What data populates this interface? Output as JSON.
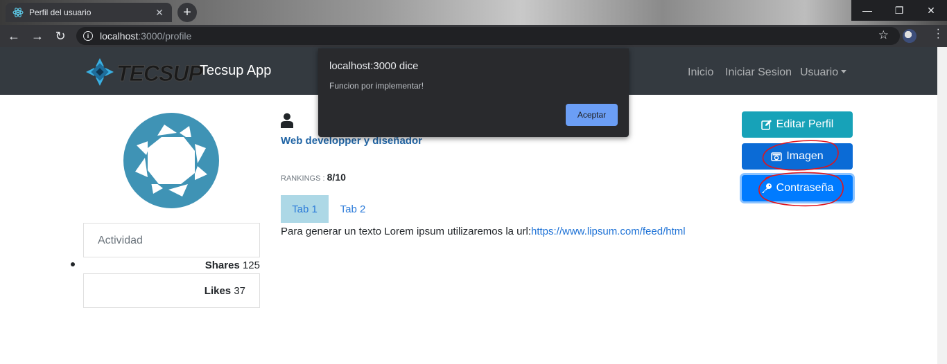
{
  "browser": {
    "tab_title": "Perfil del usuario",
    "url_host": "localhost",
    "url_path": ":3000/profile"
  },
  "navbar": {
    "brand_word": "TECSUP",
    "brand_name": "Tecsup App",
    "links": [
      "Inicio",
      "Iniciar Sesion",
      "Usuario"
    ]
  },
  "sidebar": {
    "activity_label": "Actividad",
    "shares_label": "Shares",
    "shares_value": "125",
    "likes_label": "Likes",
    "likes_value": "37"
  },
  "profile": {
    "subtitle": "Web developper y diseñador",
    "rankings_label": "RANKINGS :",
    "rankings_value": "8/10",
    "tabs": [
      "Tab 1",
      "Tab 2"
    ],
    "lorem_text": "Para generar un texto Lorem ipsum utilizaremos la url:",
    "lorem_link": "https://www.lipsum.com/feed/html"
  },
  "actions": {
    "edit_label": "Editar Perfil",
    "image_label": "Imagen",
    "password_label": "Contraseña"
  },
  "dialog": {
    "title": "localhost:3000 dice",
    "message": "Funcion por implementar!",
    "ok_label": "Aceptar"
  },
  "colors": {
    "navbar_bg": "#343a40",
    "btn_info": "#17a2b8",
    "btn_primary": "#007bff",
    "annotation_red": "#e0141c",
    "profile_circle": "#3f93b5"
  },
  "icons": [
    "react-favicon-icon",
    "close-tab-icon",
    "new-tab-icon",
    "back-icon",
    "forward-icon",
    "reload-icon",
    "info-icon",
    "star-icon",
    "profile-avatar-icon",
    "user-icon",
    "edit-icon",
    "camera-icon",
    "key-icon"
  ]
}
